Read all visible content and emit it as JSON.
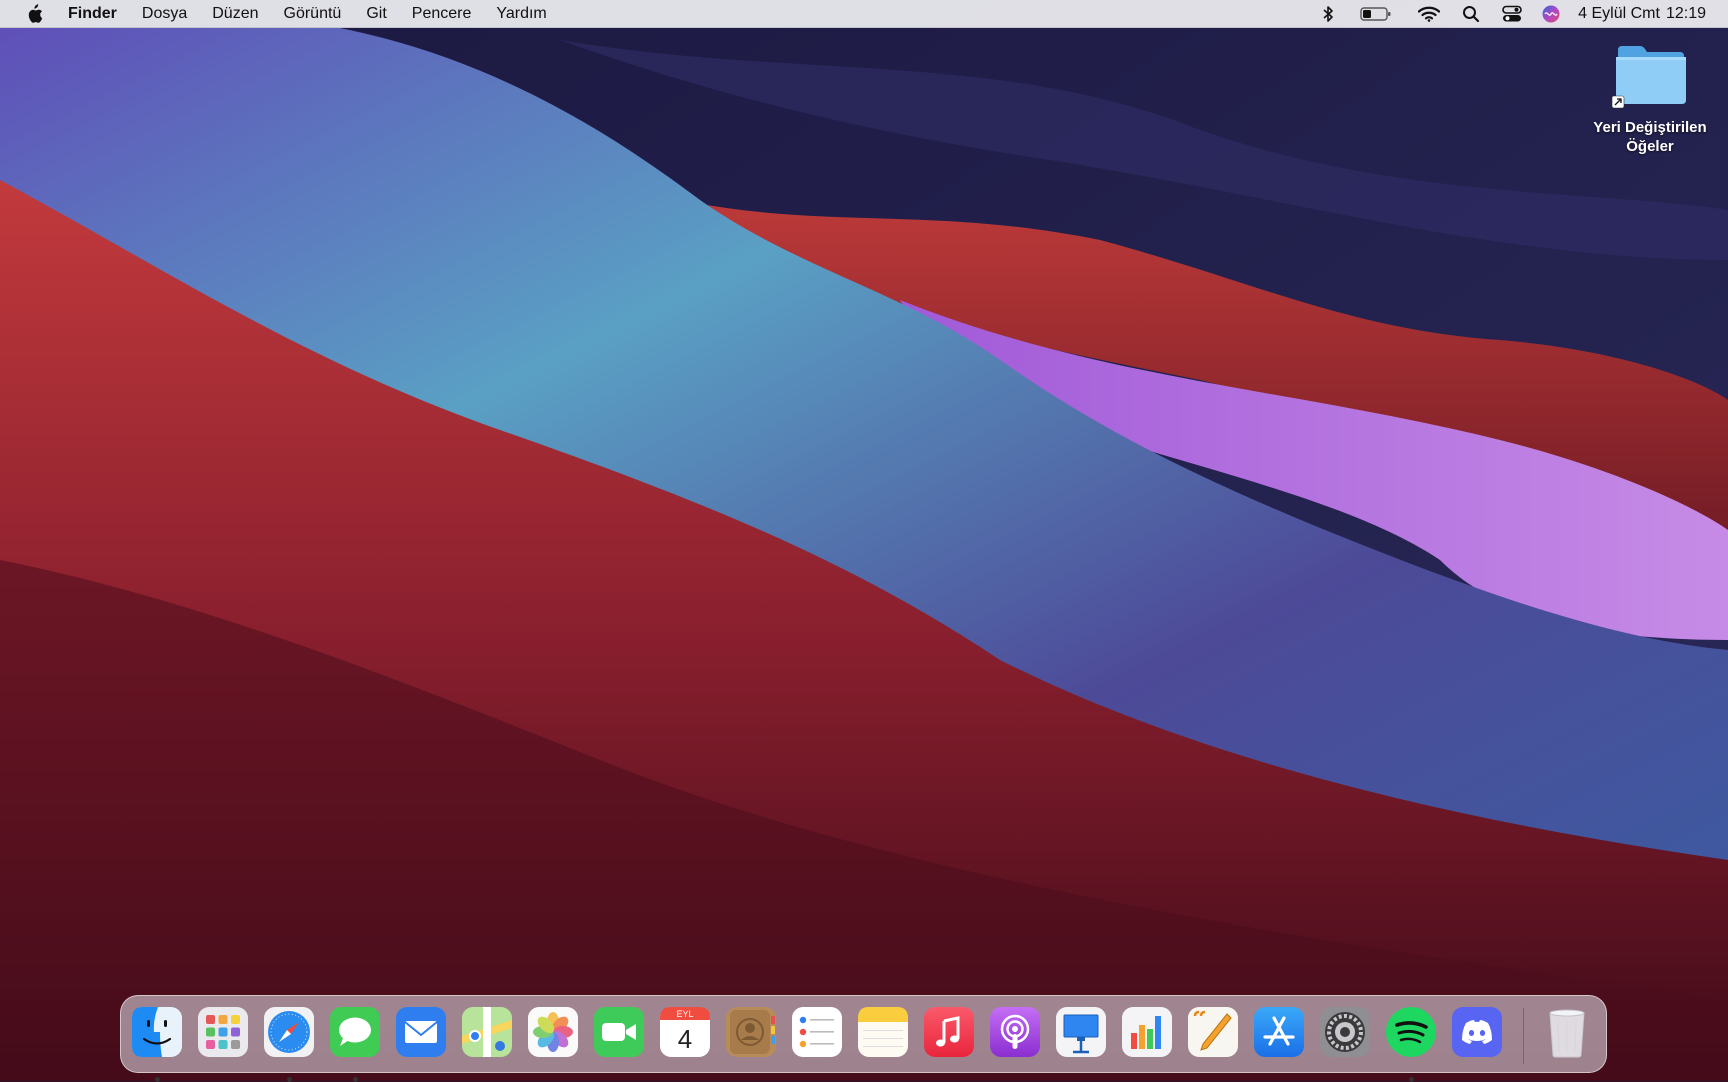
{
  "menubar": {
    "app_name": "Finder",
    "items": [
      "Dosya",
      "Düzen",
      "Görüntü",
      "Git",
      "Pencere",
      "Yardım"
    ],
    "clock": {
      "date": "4 Eylül Cmt",
      "time": "12:19"
    }
  },
  "desktop": {
    "folder_label": "Yeri Değiştirilen Öğeler"
  },
  "dock": {
    "apps": [
      {
        "name": "Finder",
        "running": true
      },
      {
        "name": "Launchpad",
        "running": false
      },
      {
        "name": "Safari",
        "running": true
      },
      {
        "name": "Messages",
        "running": true
      },
      {
        "name": "Mail",
        "running": false
      },
      {
        "name": "Maps",
        "running": false
      },
      {
        "name": "Photos",
        "running": false
      },
      {
        "name": "FaceTime",
        "running": false
      },
      {
        "name": "Calendar",
        "running": false
      },
      {
        "name": "Contacts",
        "running": false
      },
      {
        "name": "Reminders",
        "running": false
      },
      {
        "name": "Notes",
        "running": false
      },
      {
        "name": "Music",
        "running": false
      },
      {
        "name": "Podcasts",
        "running": false
      },
      {
        "name": "Keynote",
        "running": false
      },
      {
        "name": "Numbers",
        "running": false
      },
      {
        "name": "Pages",
        "running": false
      },
      {
        "name": "App Store",
        "running": false
      },
      {
        "name": "System Preferences",
        "running": false
      },
      {
        "name": "Spotify",
        "running": true
      },
      {
        "name": "Discord",
        "running": false
      },
      {
        "name": "Trash",
        "running": false
      }
    ],
    "calendar": {
      "month": "EYL",
      "day": "4"
    }
  },
  "colors": {
    "menubar_bg": "#ECECF0",
    "finder_blue": "#1E8BF5",
    "spotify_green": "#1ED760",
    "discord_blurple": "#5865F2"
  }
}
